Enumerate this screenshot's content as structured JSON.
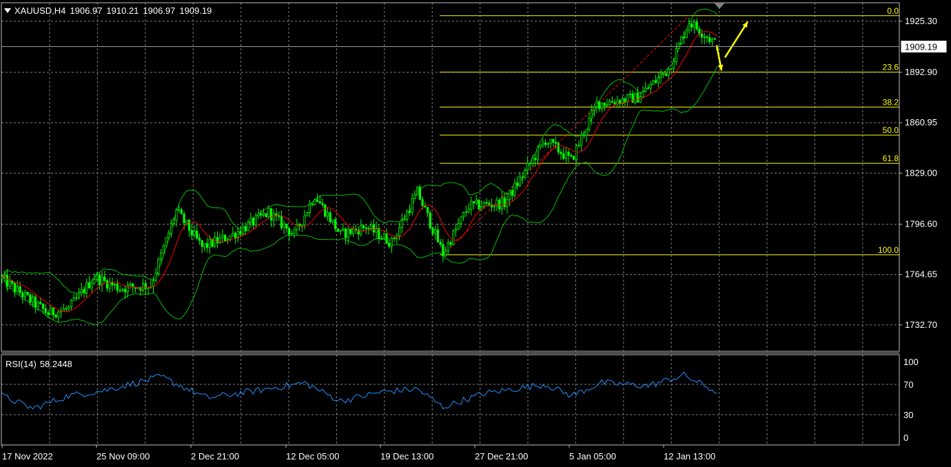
{
  "header": {
    "symbol": "XAUUSD,H4",
    "open": "1906.97",
    "high": "1910.21",
    "low": "1906.97",
    "close": "1909.19"
  },
  "colors": {
    "background": "#000000",
    "grid": "#7f7f7f",
    "bull_candle": "#00ff00",
    "bear_candle": "#00ff00",
    "ma_fast": "#ff0000",
    "bollinger": "#00c000",
    "fibo": "#ffff00",
    "rsi_line": "#1e90ff",
    "arrow": "#ffff00",
    "text": "#ffffff"
  },
  "price_axis": {
    "labels": [
      "1925.30",
      "1892.90",
      "1860.95",
      "1829.00",
      "1796.60",
      "1764.65",
      "1732.70"
    ],
    "current_price_label": "1909.19",
    "range": [
      1716,
      1937
    ]
  },
  "time_axis": {
    "labels": [
      "17 Nov 2022",
      "25 Nov 09:00",
      "2 Dec 21:00",
      "12 Dec 05:00",
      "19 Dec 13:00",
      "27 Dec 21:00",
      "5 Jan 05:00",
      "12 Jan 13:00"
    ]
  },
  "fibonacci": {
    "levels": [
      {
        "label": "0.0",
        "price": 1928.8
      },
      {
        "label": "23.6",
        "price": 1893.0
      },
      {
        "label": "38.2",
        "price": 1870.9
      },
      {
        "label": "50.0",
        "price": 1853.1
      },
      {
        "label": "61.8",
        "price": 1835.2
      },
      {
        "label": "100.0",
        "price": 1777.2
      }
    ],
    "swing_low": {
      "date": "20 Dec 2022",
      "price": 1777.2
    },
    "swing_high": {
      "date": "13 Jan 2023",
      "price": 1928.8
    }
  },
  "annotations": {
    "arrow_down": {
      "from_price": 1910,
      "to_price": 1894
    },
    "arrow_up": {
      "from_price": 1894,
      "to_price": 1925
    }
  },
  "rsi": {
    "label": "RSI(14)",
    "value": "58.2448",
    "levels_labels": [
      "100",
      "70",
      "30",
      "0"
    ],
    "levels": [
      100,
      70,
      30,
      0
    ]
  },
  "chart_data": {
    "type": "candlestick",
    "title": "XAUUSD,H4",
    "xlabel": "",
    "ylabel": "",
    "ylim": [
      1716,
      1937
    ],
    "bars": 280,
    "price_waypoints": [
      {
        "bar": 0,
        "price": 1762
      },
      {
        "bar": 8,
        "price": 1752
      },
      {
        "bar": 18,
        "price": 1740
      },
      {
        "bar": 26,
        "price": 1743
      },
      {
        "bar": 36,
        "price": 1763
      },
      {
        "bar": 46,
        "price": 1756
      },
      {
        "bar": 58,
        "price": 1758
      },
      {
        "bar": 68,
        "price": 1805
      },
      {
        "bar": 78,
        "price": 1782
      },
      {
        "bar": 90,
        "price": 1790
      },
      {
        "bar": 104,
        "price": 1804
      },
      {
        "bar": 114,
        "price": 1790
      },
      {
        "bar": 122,
        "price": 1815
      },
      {
        "bar": 132,
        "price": 1790
      },
      {
        "bar": 142,
        "price": 1795
      },
      {
        "bar": 152,
        "price": 1785
      },
      {
        "bar": 162,
        "price": 1817
      },
      {
        "bar": 172,
        "price": 1778
      },
      {
        "bar": 182,
        "price": 1808
      },
      {
        "bar": 196,
        "price": 1810
      },
      {
        "bar": 212,
        "price": 1850
      },
      {
        "bar": 222,
        "price": 1837
      },
      {
        "bar": 232,
        "price": 1873
      },
      {
        "bar": 248,
        "price": 1877
      },
      {
        "bar": 260,
        "price": 1895
      },
      {
        "bar": 268,
        "price": 1925
      },
      {
        "bar": 280,
        "price": 1909
      }
    ],
    "rsi_waypoints": [
      {
        "bar": 0,
        "value": 55
      },
      {
        "bar": 12,
        "value": 38
      },
      {
        "bar": 26,
        "value": 55
      },
      {
        "bar": 40,
        "value": 62
      },
      {
        "bar": 62,
        "value": 80
      },
      {
        "bar": 80,
        "value": 52
      },
      {
        "bar": 100,
        "value": 62
      },
      {
        "bar": 118,
        "value": 72
      },
      {
        "bar": 132,
        "value": 48
      },
      {
        "bar": 148,
        "value": 60
      },
      {
        "bar": 162,
        "value": 64
      },
      {
        "bar": 172,
        "value": 40
      },
      {
        "bar": 188,
        "value": 58
      },
      {
        "bar": 212,
        "value": 70
      },
      {
        "bar": 222,
        "value": 55
      },
      {
        "bar": 234,
        "value": 72
      },
      {
        "bar": 252,
        "value": 68
      },
      {
        "bar": 266,
        "value": 82
      },
      {
        "bar": 280,
        "value": 58
      }
    ]
  }
}
